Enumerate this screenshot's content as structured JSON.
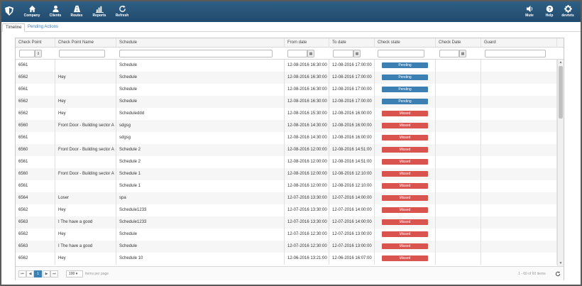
{
  "nav": {
    "company": "Company",
    "clients": "Clients",
    "routes": "Routes",
    "reports": "Reports",
    "refresh": "Refresh",
    "mute": "Mute",
    "help": "Help",
    "user": "devtvts"
  },
  "tabs": {
    "timeline": "Timeline",
    "pending": "Pending Actions"
  },
  "columns": [
    "Check Point",
    "Check Point Name",
    "Schedule",
    "From date",
    "To date",
    "Check state",
    "Check Date",
    "Guard"
  ],
  "rows": [
    [
      "6561",
      "",
      "Schedule",
      "12-08-2016 16:30:00",
      "12-08-2016 17:00:00",
      "Pending",
      "",
      ""
    ],
    [
      "6562",
      "Hey",
      "Schedule",
      "12-08-2016 16:30:00",
      "12-08-2016 17:00:00",
      "Pending",
      "",
      ""
    ],
    [
      "6561",
      "",
      "Schedule",
      "12-08-2016 16:30:00",
      "12-08-2016 17:00:00",
      "Pending",
      "",
      ""
    ],
    [
      "6562",
      "Hey",
      "Schedule",
      "12-08-2016 16:30:00",
      "12-08-2016 17:00:00",
      "Pending",
      "",
      ""
    ],
    [
      "6562",
      "Hey",
      "Scheduleddd",
      "12-08-2016 15:30:00",
      "12-08-2016 16:00:00",
      "Missed",
      "",
      ""
    ],
    [
      "6560",
      "Front Door - Building sector A",
      "sdgsg",
      "12-08-2016 14:30:00",
      "12-08-2016 16:00:00",
      "Missed",
      "",
      ""
    ],
    [
      "6561",
      "",
      "sdgsg",
      "12-08-2016 14:30:00",
      "12-08-2016 16:00:00",
      "Missed",
      "",
      ""
    ],
    [
      "6560",
      "Front Door - Building sector A",
      "Schedule 2",
      "12-08-2016 12:00:00",
      "12-08-2016 14:51:00",
      "Missed",
      "",
      ""
    ],
    [
      "6561",
      "",
      "Schedule 2",
      "12-08-2016 12:00:00",
      "12-08-2016 14:51:00",
      "Missed",
      "",
      ""
    ],
    [
      "6560",
      "Front Door - Building sector A",
      "Schedule 1",
      "12-08-2016 12:00:00",
      "12-08-2016 12:10:00",
      "Missed",
      "",
      ""
    ],
    [
      "6561",
      "",
      "Schedule 1",
      "12-08-2016 12:00:00",
      "12-08-2016 12:10:00",
      "Missed",
      "",
      ""
    ],
    [
      "6564",
      "Loser",
      "spa",
      "12-07-2016 13:30:00",
      "12-07-2016 14:00:00",
      "Missed",
      "",
      ""
    ],
    [
      "6562",
      "Hey",
      "Schedule1233",
      "12-07-2016 13:30:00",
      "12-07-2016 14:00:00",
      "Missed",
      "",
      ""
    ],
    [
      "6563",
      "I The have a good",
      "Schedule1233",
      "12-07-2016 13:30:00",
      "12-07-2016 14:00:00",
      "Missed",
      "",
      ""
    ],
    [
      "6562",
      "Hey",
      "Schedule",
      "12-07-2016 12:30:00",
      "12-07-2016 13:00:00",
      "Missed",
      "",
      ""
    ],
    [
      "6563",
      "I The have a good",
      "Schedule",
      "12-07-2016 12:30:00",
      "12-07-2016 13:00:00",
      "Missed",
      "",
      ""
    ],
    [
      "6562",
      "Hey",
      "Schedule 10",
      "12-06-2016 13:21:00",
      "12-06-2016 16:07:00",
      "Missed",
      "",
      ""
    ]
  ],
  "pager": {
    "first": "⏮",
    "prev": "◀",
    "current": "1",
    "next": "▶",
    "last": "⏭",
    "page_size": "100",
    "items_per_page": "items per page",
    "summary": "1 - 60 of 60 items"
  },
  "colors": {
    "header": "#214a6c",
    "pending": "#3c7fb3",
    "missed": "#d9534f"
  },
  "icons": {
    "company": "home-icon",
    "clients": "user-icon",
    "routes": "road-icon",
    "reports": "bar-chart-icon",
    "refresh": "refresh-icon",
    "mute": "speaker-icon",
    "help": "help-icon",
    "user": "gear-icon"
  }
}
